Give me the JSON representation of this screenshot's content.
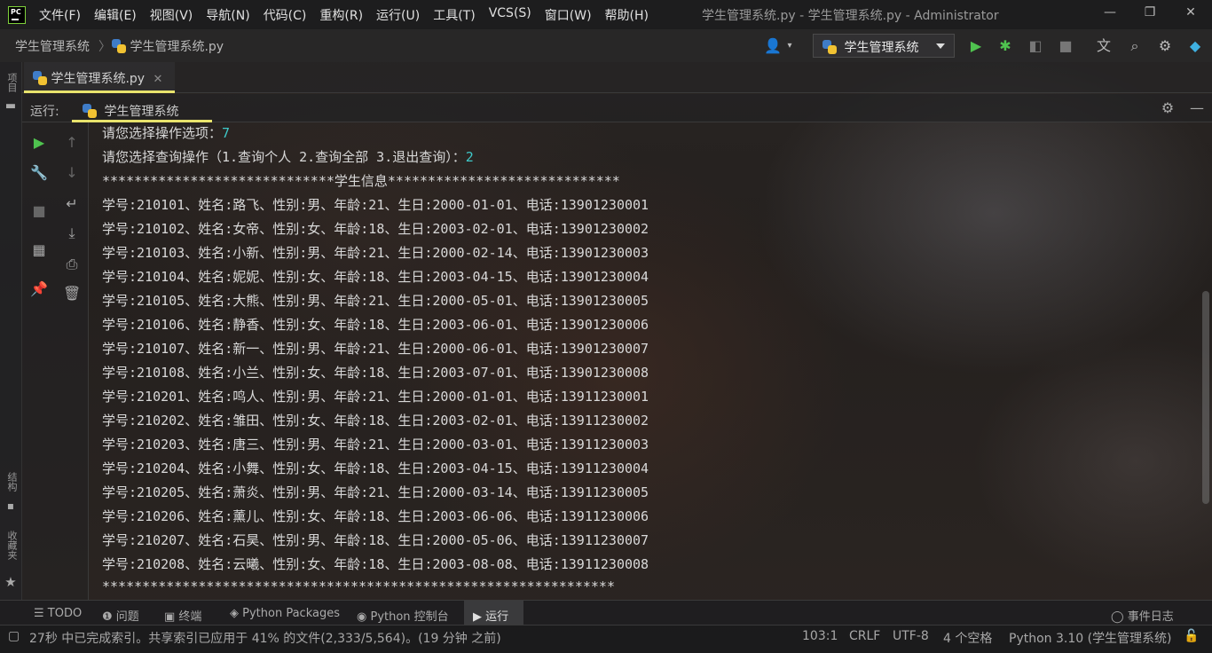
{
  "menu": {
    "items": [
      "文件(F)",
      "编辑(E)",
      "视图(V)",
      "导航(N)",
      "代码(C)",
      "重构(R)",
      "运行(U)",
      "工具(T)",
      "VCS(S)",
      "窗口(W)",
      "帮助(H)"
    ],
    "window_title": "学生管理系统.py - 学生管理系统.py - Administrator"
  },
  "breadcrumb": {
    "project": "学生管理系统",
    "file": "学生管理系统.py"
  },
  "toolbar": {
    "run_config": "学生管理系统"
  },
  "left_stripe": {
    "project": "项目",
    "structure": "结构",
    "favorites": "收藏夹"
  },
  "editor": {
    "tab_label": "学生管理系统.py"
  },
  "run_panel": {
    "label": "运行:",
    "tab_label": "学生管理系统"
  },
  "console": {
    "prompt1": "请您选择操作选项：",
    "prompt1_input": "7",
    "prompt2": "请您选择查询操作（1.查询个人 2.查询全部 3.退出查询）：",
    "prompt2_input": "2",
    "header": "*****************************学生信息*****************************",
    "records": [
      "学号:210101、姓名:路飞、性别:男、年龄:21、生日:2000-01-01、电话:13901230001",
      "学号:210102、姓名:女帝、性别:女、年龄:18、生日:2003-02-01、电话:13901230002",
      "学号:210103、姓名:小新、性别:男、年龄:21、生日:2000-02-14、电话:13901230003",
      "学号:210104、姓名:妮妮、性别:女、年龄:18、生日:2003-04-15、电话:13901230004",
      "学号:210105、姓名:大熊、性别:男、年龄:21、生日:2000-05-01、电话:13901230005",
      "学号:210106、姓名:静香、性别:女、年龄:18、生日:2003-06-01、电话:13901230006",
      "学号:210107、姓名:新一、性别:男、年龄:21、生日:2000-06-01、电话:13901230007",
      "学号:210108、姓名:小兰、性别:女、年龄:18、生日:2003-07-01、电话:13901230008",
      "学号:210201、姓名:鸣人、性别:男、年龄:21、生日:2000-01-01、电话:13911230001",
      "学号:210202、姓名:雏田、性别:女、年龄:18、生日:2003-02-01、电话:13911230002",
      "学号:210203、姓名:唐三、性别:男、年龄:21、生日:2000-03-01、电话:13911230003",
      "学号:210204、姓名:小舞、性别:女、年龄:18、生日:2003-04-15、电话:13911230004",
      "学号:210205、姓名:萧炎、性别:男、年龄:21、生日:2000-03-14、电话:13911230005",
      "学号:210206、姓名:薰儿、性别:女、年龄:18、生日:2003-06-06、电话:13911230006",
      "学号:210207、姓名:石昊、性别:男、年龄:18、生日:2000-05-06、电话:13911230007",
      "学号:210208、姓名:云曦、性别:女、年龄:18、生日:2003-08-08、电话:13911230008"
    ],
    "footer": "****************************************************************"
  },
  "tool_tabs": {
    "todo": "TODO",
    "problems": "问题",
    "terminal": "终端",
    "python_packages": "Python Packages",
    "python_console": "Python 控制台",
    "run": "运行",
    "event_log": "事件日志"
  },
  "status": {
    "message": "27秒 中已完成索引。共享索引已应用于 41% 的文件(2,333/5,564)。(19 分钟 之前)",
    "position": "103:1",
    "line_ending": "CRLF",
    "encoding": "UTF-8",
    "indent": "4 个空格",
    "interpreter": "Python 3.10 (学生管理系统)"
  },
  "colors": {
    "accent_tab": "#e8e36c",
    "run_green": "#4fc34f",
    "input_cyan": "#3fc9c9"
  }
}
